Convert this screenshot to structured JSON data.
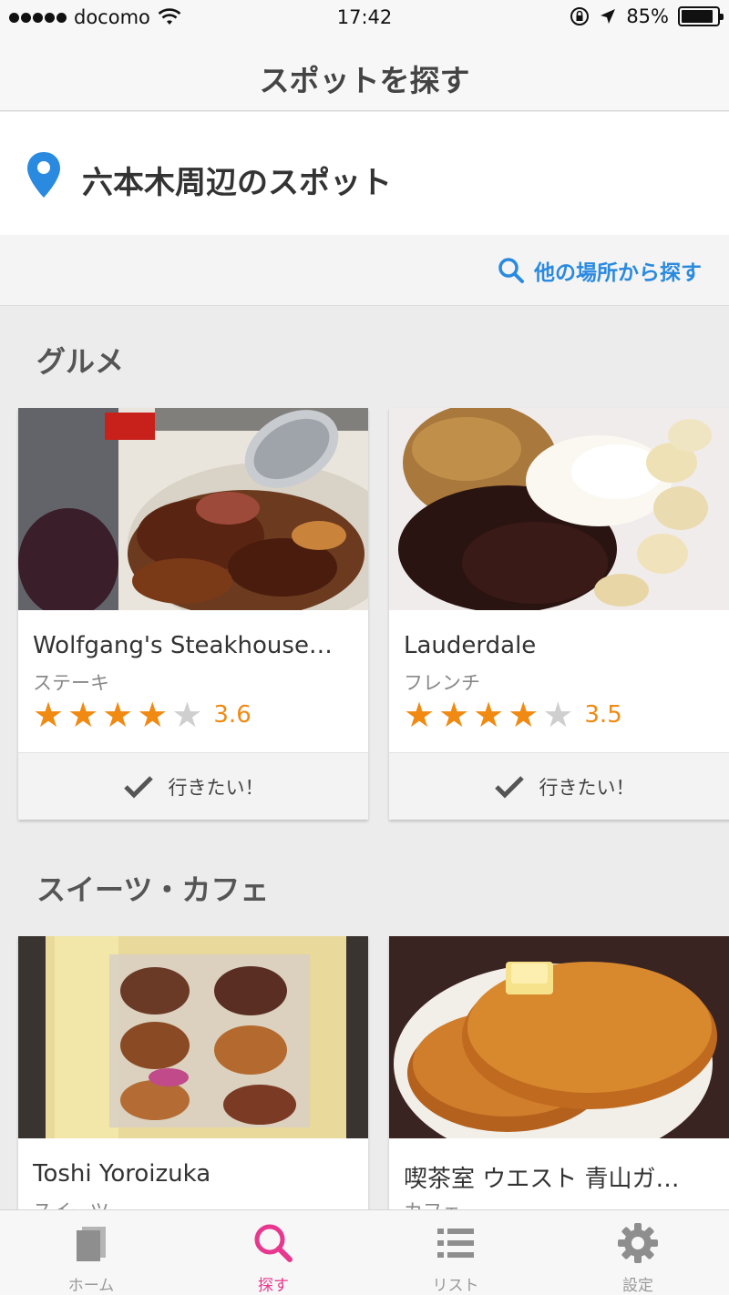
{
  "status_bar": {
    "carrier": "docomo",
    "time": "17:42",
    "battery": "85%"
  },
  "nav": {
    "title": "スポットを探す"
  },
  "location": {
    "title": "六本木周辺のスポット",
    "search_other": "他の場所から探す"
  },
  "sections": [
    {
      "title": "グルメ",
      "cards": [
        {
          "name": "Wolfgang's Steakhouse…",
          "genre": "ステーキ",
          "rating": "3.6",
          "stars": 4,
          "action": "行きたい！"
        },
        {
          "name": "Lauderdale",
          "genre": "フレンチ",
          "rating": "3.5",
          "stars": 4,
          "action": "行きたい！"
        }
      ]
    },
    {
      "title": "スイーツ・カフェ",
      "cards": [
        {
          "name": "Toshi Yoroizuka",
          "genre": "スイーツ"
        },
        {
          "name": "喫茶室 ウエスト 青山ガ…",
          "genre": "カフェ"
        }
      ]
    }
  ],
  "tabs": [
    {
      "label": "ホーム",
      "icon": "home-icon"
    },
    {
      "label": "探す",
      "icon": "search-icon",
      "active": true
    },
    {
      "label": "リスト",
      "icon": "list-icon"
    },
    {
      "label": "設定",
      "icon": "gear-icon"
    }
  ],
  "colors": {
    "accent_blue": "#2a8ae0",
    "rating_orange": "#f08a12",
    "active_tab_pink": "#e8378f"
  }
}
